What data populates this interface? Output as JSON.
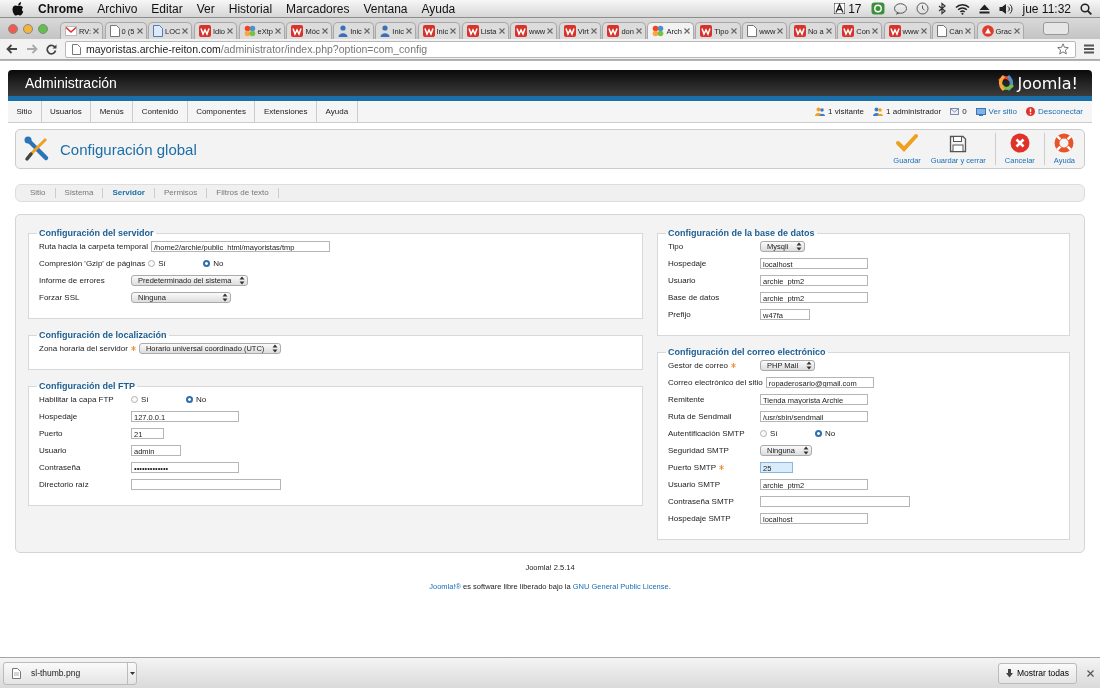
{
  "menubar": {
    "app": "Chrome",
    "menus": [
      "Archivo",
      "Editar",
      "Ver",
      "Historial",
      "Marcadores",
      "Ventana",
      "Ayuda"
    ],
    "badge": "17",
    "clock": "jue 11:32"
  },
  "browser": {
    "tabs": [
      {
        "label": "RV:",
        "kind": "mail",
        "selected": false
      },
      {
        "label": "0 (5",
        "kind": "page",
        "selected": false
      },
      {
        "label": "LOC",
        "kind": "doc",
        "selected": false
      },
      {
        "label": "Idio",
        "kind": "w",
        "selected": false
      },
      {
        "label": "eXtp",
        "kind": "joomla",
        "selected": false
      },
      {
        "label": "Móc",
        "kind": "w",
        "selected": false
      },
      {
        "label": "Inic",
        "kind": "person",
        "selected": false
      },
      {
        "label": "Inic",
        "kind": "person",
        "selected": false
      },
      {
        "label": "Inic",
        "kind": "w",
        "selected": false
      },
      {
        "label": "Lista",
        "kind": "w",
        "selected": false
      },
      {
        "label": "www",
        "kind": "w",
        "selected": false
      },
      {
        "label": "Virt",
        "kind": "w",
        "selected": false
      },
      {
        "label": "don",
        "kind": "w",
        "selected": false
      },
      {
        "label": "Arch",
        "kind": "joomla",
        "selected": true
      },
      {
        "label": "Tipo",
        "kind": "w",
        "selected": false
      },
      {
        "label": "www",
        "kind": "page",
        "selected": false
      },
      {
        "label": "No a",
        "kind": "w",
        "selected": false
      },
      {
        "label": "Con",
        "kind": "w",
        "selected": false
      },
      {
        "label": "www",
        "kind": "w",
        "selected": false
      },
      {
        "label": "Cán",
        "kind": "page",
        "selected": false
      },
      {
        "label": "Grac",
        "kind": "circle",
        "selected": false
      }
    ],
    "url": {
      "host": "mayoristas.archie-reiton.com",
      "path": "/administrator/index.php?option=com_config"
    }
  },
  "admin": {
    "title": "Administración",
    "logo": "Joomla!",
    "menu": [
      "Sitio",
      "Usuarios",
      "Menús",
      "Contenido",
      "Componentes",
      "Extensiones",
      "Ayuda"
    ],
    "status": [
      {
        "kind": "visitors",
        "label": "1 visitante"
      },
      {
        "kind": "admins",
        "label": "1 administrador"
      },
      {
        "kind": "messages",
        "label": "0"
      },
      {
        "kind": "view-site",
        "label": "Ver sitio"
      },
      {
        "kind": "logout",
        "label": "Desconectar"
      }
    ]
  },
  "page": {
    "title": "Configuración global",
    "actions": [
      {
        "kind": "save",
        "label": "Guardar"
      },
      {
        "kind": "save-close",
        "label": "Guardar y cerrar"
      },
      {
        "kind": "cancel",
        "label": "Cancelar"
      },
      {
        "kind": "help",
        "label": "Ayuda"
      }
    ]
  },
  "subtabs": [
    {
      "label": "Sitio",
      "selected": false
    },
    {
      "label": "Sistema",
      "selected": false
    },
    {
      "label": "Servidor",
      "selected": true
    },
    {
      "label": "Permisos",
      "selected": false
    },
    {
      "label": "Filtros de texto",
      "selected": false
    }
  ],
  "left": [
    {
      "legend": "Configuración del servidor",
      "rows": [
        {
          "kind": "text",
          "label": "Ruta hacia la carpeta temporal",
          "value": "/home2/archie/public_html/mayoristas/tmp"
        },
        {
          "kind": "radio",
          "label": "Compresión 'Gzip' de páginas",
          "options": [
            {
              "label": "Sí",
              "selected": false
            },
            {
              "label": "No",
              "selected": true
            }
          ]
        },
        {
          "kind": "select",
          "label": "Informe de errores",
          "value": "Predeterminado del sistema"
        },
        {
          "kind": "select",
          "label": "Forzar SSL",
          "value": "Ninguna"
        }
      ]
    },
    {
      "legend": "Configuración de localización",
      "rows": [
        {
          "kind": "select",
          "label": "Zona horaria del servidor",
          "value": "Horario universal coordinado (UTC)",
          "required": true
        }
      ]
    },
    {
      "legend": "Configuración del FTP",
      "rows": [
        {
          "kind": "radio",
          "label": "Habilitar la capa FTP",
          "options": [
            {
              "label": "Sí",
              "selected": false
            },
            {
              "label": "No",
              "selected": true
            }
          ]
        },
        {
          "kind": "text",
          "label": "Hospedaje",
          "value": "127.0.0.1"
        },
        {
          "kind": "text",
          "label": "Puerto",
          "value": "21"
        },
        {
          "kind": "text",
          "label": "Usuario",
          "value": "admin"
        },
        {
          "kind": "password",
          "label": "Contraseña",
          "value": "•••••••••••••"
        },
        {
          "kind": "text",
          "label": "Directorio raíz"
        }
      ]
    }
  ],
  "right": [
    {
      "legend": "Configuración de la base de datos",
      "rows": [
        {
          "kind": "select",
          "label": "Tipo",
          "value": "Mysqli"
        },
        {
          "kind": "text",
          "label": "Hospedaje",
          "value": "localhost"
        },
        {
          "kind": "text",
          "label": "Usuario",
          "value": "archie_ptm2"
        },
        {
          "kind": "text",
          "label": "Base de datos",
          "value": "archie_ptm2"
        },
        {
          "kind": "text",
          "label": "Prefijo",
          "value": "w47fa_"
        }
      ]
    },
    {
      "legend": "Configuración del correo electrónico",
      "rows": [
        {
          "kind": "select",
          "label": "Gestor de correo",
          "value": "PHP Mail",
          "required": true
        },
        {
          "kind": "text",
          "label": "Correo electrónico del sitio",
          "value": "ropaderosario@gmail.com"
        },
        {
          "kind": "text",
          "label": "Remitente",
          "value": "Tienda mayorista Archie"
        },
        {
          "kind": "text",
          "label": "Ruta de Sendmail",
          "value": "/usr/sbin/sendmail"
        },
        {
          "kind": "radio",
          "label": "Autentificación SMTP",
          "options": [
            {
              "label": "Sí",
              "selected": false
            },
            {
              "label": "No",
              "selected": true
            }
          ]
        },
        {
          "kind": "select",
          "label": "Seguridad SMTP",
          "value": "Ninguna"
        },
        {
          "kind": "text",
          "label": "Puerto SMTP",
          "value": "25",
          "required": true,
          "focused": true
        },
        {
          "kind": "text",
          "label": "Usuario SMTP",
          "value": "archie_ptm2"
        },
        {
          "kind": "text",
          "label": "Contraseña SMTP"
        },
        {
          "kind": "text",
          "label": "Hospedaje SMTP",
          "value": "localhost"
        }
      ]
    }
  ],
  "footer": {
    "version": "Joomla! 2.5.14",
    "link": "Joomla!®",
    "text": "es software libre liberado bajo la",
    "license": "GNU General Public License",
    "end": "."
  },
  "downloads": {
    "file": "sl-thumb.png",
    "show_all": "Mostrar todas"
  }
}
